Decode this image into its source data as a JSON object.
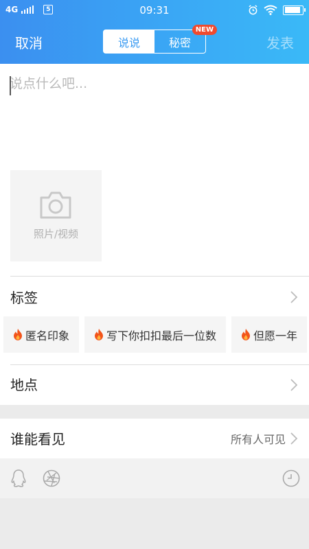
{
  "status_bar": {
    "network": "4G",
    "sim_indicator": "5",
    "time": "09:31"
  },
  "header": {
    "cancel_label": "取消",
    "publish_label": "发表",
    "tabs": [
      {
        "label": "说说",
        "active": true
      },
      {
        "label": "秘密",
        "active": false
      }
    ],
    "new_badge": "NEW",
    "accent_color": "#3a9bf2"
  },
  "compose": {
    "placeholder": "说点什么吧...",
    "value": ""
  },
  "media": {
    "label": "照片/视频",
    "icon": "camera-icon"
  },
  "tags_section": {
    "title": "标签",
    "tags": [
      {
        "icon": "flame-icon",
        "label": "匿名印象"
      },
      {
        "icon": "flame-icon",
        "label": "写下你扣扣最后一位数"
      },
      {
        "icon": "flame-icon",
        "label": "但愿一年"
      }
    ]
  },
  "location_section": {
    "title": "地点"
  },
  "visibility_section": {
    "title": "谁能看见",
    "value": "所有人可见"
  },
  "toolbar": {
    "icons": [
      "qq-penguin-icon",
      "aperture-icon",
      "clock-icon"
    ]
  }
}
